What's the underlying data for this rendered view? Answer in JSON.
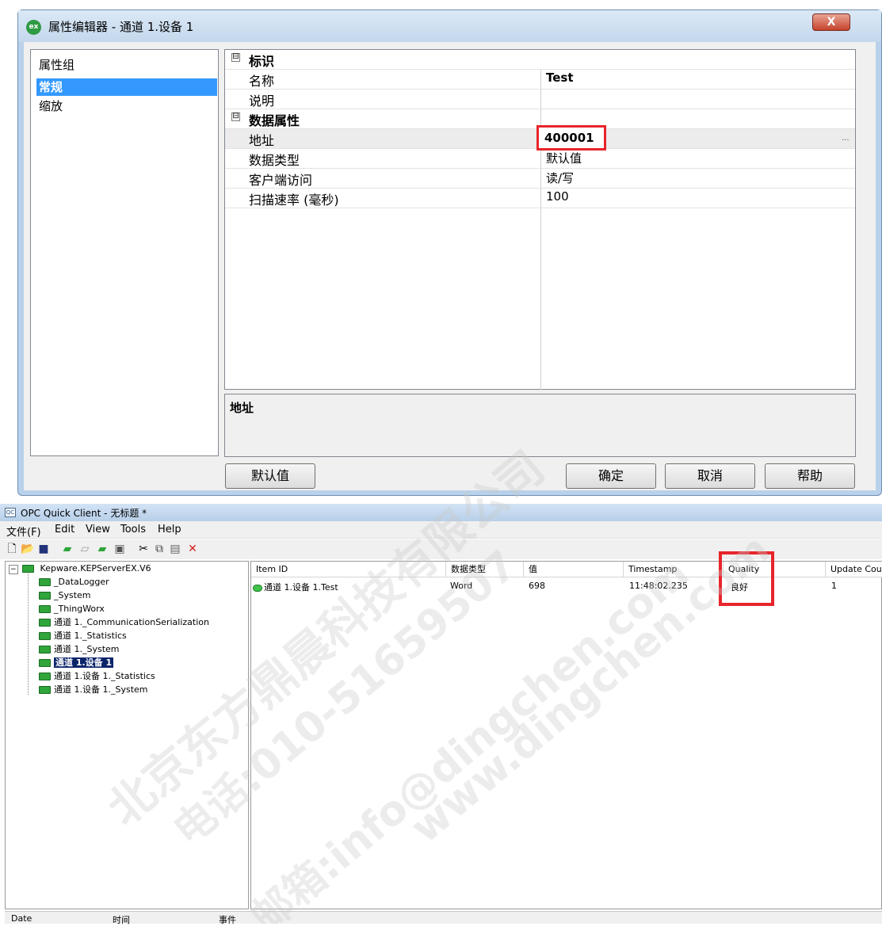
{
  "dialog": {
    "icon_text": "ex",
    "title": "属性编辑器 - 通道 1.设备 1",
    "close_label": "X",
    "group_header": "属性组",
    "groups": [
      "常规",
      "缩放"
    ],
    "categories": [
      {
        "label": "标识",
        "toggle": "⊟"
      },
      {
        "label": "数据属性",
        "toggle": "⊟"
      }
    ],
    "properties": [
      {
        "name": "名称",
        "value": "Test"
      },
      {
        "name": "说明",
        "value": ""
      },
      {
        "name": "地址",
        "value": "400001"
      },
      {
        "name": "数据类型",
        "value": "默认值"
      },
      {
        "name": "客户端访问",
        "value": "读/写"
      },
      {
        "name": "扫描速率 (毫秒)",
        "value": "100"
      }
    ],
    "ellipsis": "...",
    "description_title": "地址",
    "buttons": {
      "default": "默认值",
      "ok": "确定",
      "cancel": "取消",
      "help": "帮助"
    }
  },
  "opc": {
    "icon_text": "QC",
    "title": "OPC Quick Client - 无标题 *",
    "menus": [
      "文件(F)",
      "Edit",
      "View",
      "Tools",
      "Help"
    ],
    "toolbar_icons": [
      "new-icon",
      "open-icon",
      "save-icon",
      "new-server-icon",
      "new-group-icon",
      "new-item-icon",
      "properties-icon",
      "cut-icon",
      "copy-icon",
      "paste-icon",
      "delete-icon"
    ],
    "tree": {
      "root": "Kepware.KEPServerEX.V6",
      "children": [
        "_DataLogger",
        "_System",
        "_ThingWorx",
        "通道 1._CommunicationSerialization",
        "通道 1._Statistics",
        "通道 1._System",
        "通道 1.设备 1",
        "通道 1.设备 1._Statistics",
        "通道 1.设备 1._System"
      ]
    },
    "list": {
      "headers": [
        "Item ID",
        "数据类型",
        "值",
        "Timestamp",
        "Quality",
        "Update Count"
      ],
      "rows": [
        {
          "item_id": "通道 1.设备 1.Test",
          "data_type": "Word",
          "value": "698",
          "timestamp": "11:48:02.235",
          "quality": "良好",
          "update_count": "1"
        }
      ]
    },
    "status": {
      "date": "Date",
      "time": "时间",
      "event": "事件"
    }
  },
  "watermark": [
    "北京东方鼎晨科技有限公司",
    "电话:010-51659507",
    "邮箱:info@dingchen.com",
    "www.dingchen.com"
  ],
  "colors": {
    "highlight_red": "#e8242b",
    "selection": "#3399ff",
    "folder_green": "#2fa53a"
  }
}
